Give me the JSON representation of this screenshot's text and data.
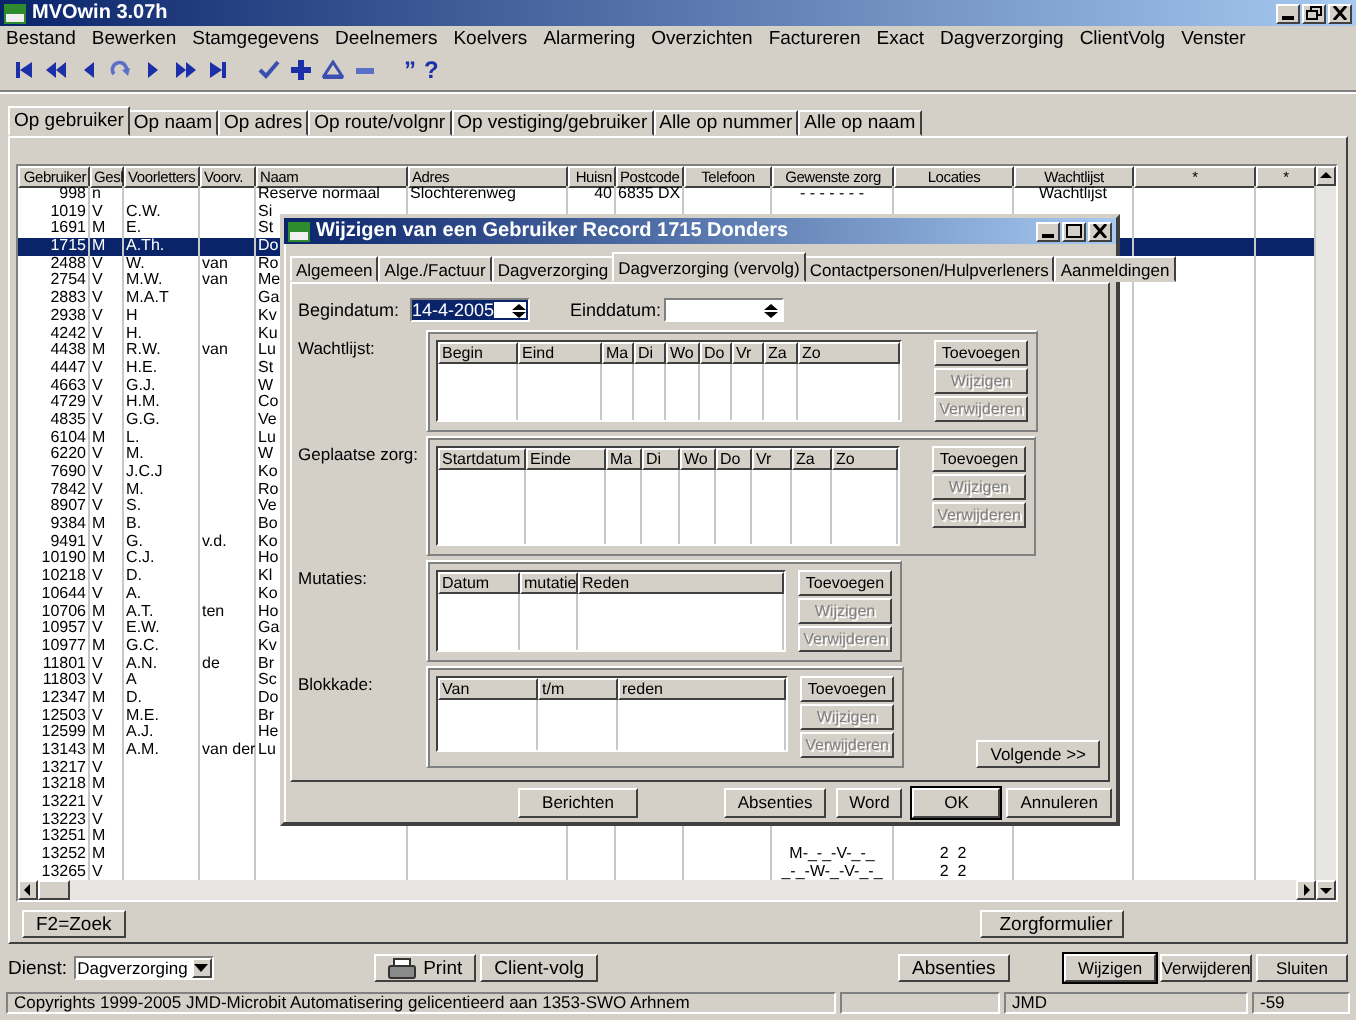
{
  "window": {
    "title": "MVOwin 3.07h"
  },
  "menu": [
    "Bestand",
    "Bewerken",
    "Stamgegevens",
    "Deelnemers",
    "Koelvers",
    "Alarmering",
    "Overzichten",
    "Factureren",
    "Exact",
    "Dagverzorging",
    "ClientVolg",
    "Venster"
  ],
  "toolbar": [
    {
      "kind": "first"
    },
    {
      "kind": "rewind"
    },
    {
      "kind": "previous"
    },
    {
      "kind": "refresh"
    },
    {
      "kind": "next"
    },
    {
      "kind": "forward"
    },
    {
      "kind": "last"
    },
    {
      "kind": "confirm"
    },
    {
      "kind": "add"
    },
    {
      "kind": "edit"
    },
    {
      "kind": "remove"
    },
    {
      "kind": "text",
      "text": "”"
    },
    {
      "kind": "text",
      "text": "?"
    }
  ],
  "tabs": [
    {
      "label": "Op gebruiker",
      "selected": true
    },
    {
      "label": "Op naam",
      "selected": false
    },
    {
      "label": "Op  adres",
      "selected": false
    },
    {
      "label": "Op route/volgnr",
      "selected": false
    },
    {
      "label": "Op vestiging/gebruiker",
      "selected": false
    },
    {
      "label": "Alle op nummer",
      "selected": false
    },
    {
      "label": "Alle op naam",
      "selected": false
    }
  ],
  "table": {
    "columns": [
      "Gebruiker",
      "Gesl",
      "Voorletters",
      "Voorv.",
      "Naam",
      "Adres",
      "Huisn",
      "Postcode",
      "Telefoon",
      "Gewenste zorg",
      "Locaties",
      "Wachtlijst",
      "*",
      "*"
    ],
    "rows": [
      {
        "gebruiker": "998",
        "gesl": "n",
        "naam": "Reserve normaal",
        "adres": "Slochterenweg",
        "huisnr": "40",
        "postcode": "6835 DX",
        "zorg": "- - - - - - -",
        "wachtlijst": "Wachtlijst",
        "selected": false
      },
      {
        "gebruiker": "1019",
        "gesl": "V",
        "voorletters": "C.W.",
        "naam": "Si",
        "selected": false
      },
      {
        "gebruiker": "1691",
        "gesl": "M",
        "voorletters": "E.",
        "naam": "St",
        "selected": false
      },
      {
        "gebruiker": "1715",
        "gesl": "M",
        "voorletters": "A.Th.",
        "naam": "Do",
        "selected": true
      },
      {
        "gebruiker": "2488",
        "gesl": "V",
        "voorletters": "W.",
        "voorv": "van",
        "naam": "Ro",
        "selected": false
      },
      {
        "gebruiker": "2754",
        "gesl": "V",
        "voorletters": "M.W.",
        "voorv": "van",
        "naam": "Me",
        "selected": false
      },
      {
        "gebruiker": "2883",
        "gesl": "V",
        "voorletters": "M.A.T",
        "naam": "Ga",
        "selected": false
      },
      {
        "gebruiker": "2938",
        "gesl": "V",
        "voorletters": "H",
        "naam": "Kv",
        "selected": false
      },
      {
        "gebruiker": "4242",
        "gesl": "V",
        "voorletters": "H.",
        "naam": "Ku",
        "selected": false
      },
      {
        "gebruiker": "4438",
        "gesl": "M",
        "voorletters": "R.W.",
        "voorv": "van",
        "naam": "Lu",
        "selected": false
      },
      {
        "gebruiker": "4447",
        "gesl": "V",
        "voorletters": "H.E.",
        "naam": "St",
        "selected": false
      },
      {
        "gebruiker": "4663",
        "gesl": "V",
        "voorletters": "G.J.",
        "naam": "W",
        "selected": false
      },
      {
        "gebruiker": "4729",
        "gesl": "V",
        "voorletters": "H.M.",
        "naam": "Co",
        "selected": false
      },
      {
        "gebruiker": "4835",
        "gesl": "V",
        "voorletters": "G.G.",
        "naam": "Ve",
        "selected": false
      },
      {
        "gebruiker": "6104",
        "gesl": "M",
        "voorletters": "L.",
        "naam": "Lu",
        "selected": false
      },
      {
        "gebruiker": "6220",
        "gesl": "V",
        "voorletters": "M.",
        "naam": "W",
        "selected": false
      },
      {
        "gebruiker": "7690",
        "gesl": "V",
        "voorletters": "J.C.J",
        "naam": "Ko",
        "selected": false
      },
      {
        "gebruiker": "7842",
        "gesl": "V",
        "voorletters": "M.",
        "naam": "Ro",
        "selected": false
      },
      {
        "gebruiker": "8907",
        "gesl": "V",
        "voorletters": "S.",
        "naam": "Ve",
        "selected": false
      },
      {
        "gebruiker": "9384",
        "gesl": "M",
        "voorletters": "B.",
        "naam": "Bo",
        "selected": false
      },
      {
        "gebruiker": "9491",
        "gesl": "V",
        "voorletters": "G.",
        "voorv": "v.d.",
        "naam": "Ko",
        "selected": false
      },
      {
        "gebruiker": "10190",
        "gesl": "M",
        "voorletters": "C.J.",
        "naam": "Ho",
        "selected": false
      },
      {
        "gebruiker": "10218",
        "gesl": "V",
        "voorletters": "D.",
        "naam": "Kl",
        "selected": false
      },
      {
        "gebruiker": "10644",
        "gesl": "V",
        "voorletters": "A.",
        "naam": "Ko",
        "selected": false
      },
      {
        "gebruiker": "10706",
        "gesl": "M",
        "voorletters": "A.T.",
        "voorv": "ten",
        "naam": "Ho",
        "selected": false
      },
      {
        "gebruiker": "10957",
        "gesl": "V",
        "voorletters": "E.W.",
        "naam": "Ga",
        "selected": false
      },
      {
        "gebruiker": "10977",
        "gesl": "M",
        "voorletters": "G.C.",
        "naam": "Kv",
        "selected": false
      },
      {
        "gebruiker": "11801",
        "gesl": "V",
        "voorletters": "A.N.",
        "voorv": "de",
        "naam": "Br",
        "selected": false
      },
      {
        "gebruiker": "11803",
        "gesl": "V",
        "voorletters": "A",
        "naam": "Sc",
        "selected": false
      },
      {
        "gebruiker": "12347",
        "gesl": "M",
        "voorletters": "D.",
        "naam": "Do",
        "selected": false
      },
      {
        "gebruiker": "12503",
        "gesl": "V",
        "voorletters": "M.E.",
        "naam": "Br",
        "selected": false
      },
      {
        "gebruiker": "12599",
        "gesl": "M",
        "voorletters": "A.J.",
        "naam": "He",
        "selected": false
      },
      {
        "gebruiker": "13143",
        "gesl": "M",
        "voorletters": "A.M.",
        "voorv": "van der",
        "naam": "Lu",
        "selected": false
      },
      {
        "gebruiker": "13217",
        "gesl": "V",
        "selected": false
      },
      {
        "gebruiker": "13218",
        "gesl": "M",
        "selected": false
      },
      {
        "gebruiker": "13221",
        "gesl": "V",
        "selected": false
      },
      {
        "gebruiker": "13223",
        "gesl": "V",
        "selected": false
      },
      {
        "gebruiker": "13251",
        "gesl": "M",
        "selected": false
      },
      {
        "gebruiker": "13252",
        "gesl": "M",
        "zorg": "M-_-_-V-_-_",
        "locaties": "2  2",
        "selected": false
      },
      {
        "gebruiker": "13265",
        "gesl": "V",
        "zorg": "_-_-W-_-V-_-_",
        "locaties": "2  2",
        "selected": false
      }
    ]
  },
  "search_button": "F2=Zoek",
  "form_button": "Zorgformulier",
  "service": {
    "label": "Dienst:",
    "value": "Dagverzorging"
  },
  "print_buttons": [
    "Print",
    "Client-volg"
  ],
  "center_buttons": [
    "Absenties"
  ],
  "action_buttons": [
    {
      "label": "Wijzigen",
      "default": true
    },
    {
      "label": "Verwijderen",
      "default": false
    },
    {
      "label": "Sluiten",
      "default": false
    }
  ],
  "status_bar": [
    "Copyrights 1999-2005 JMD-Microbit Automatisering gelicentieerd aan 1353-SWO Arhnem",
    "JMD",
    "-59"
  ],
  "dialog": {
    "title": "Wijzigen van een Gebruiker Record 1715 Donders",
    "tabs": [
      {
        "label": "Algemeen",
        "selected": false
      },
      {
        "label": "Alge./Factuur",
        "selected": false
      },
      {
        "label": "Dagverzorging",
        "selected": false
      },
      {
        "label": "Dagverzorging (vervolg)",
        "selected": true
      },
      {
        "label": "Contactpersonen/Hulpverleners",
        "selected": false
      },
      {
        "label": "Aanmeldingen",
        "selected": false
      }
    ],
    "dates": [
      {
        "label": "Begindatum:",
        "value": "14-4-2005",
        "highlighted": true
      },
      {
        "label": "Einddatum:",
        "highlighted": false
      }
    ],
    "sections": [
      {
        "label": "Wachtlijst:",
        "columns": [
          "Begin",
          "Eind",
          "Ma",
          "Di",
          "Wo",
          "Do",
          "Vr",
          "Za",
          "Zo"
        ],
        "buttons": [
          {
            "label": "Toevoegen",
            "disabled": false
          },
          {
            "label": "Wijzigen",
            "disabled": true
          },
          {
            "label": "Verwijderen",
            "disabled": true
          }
        ]
      },
      {
        "label": "Geplaatse zorg:",
        "columns": [
          "Startdatum",
          "Einde",
          "Ma",
          "Di",
          "Wo",
          "Do",
          "Vr",
          "Za",
          "Zo"
        ],
        "buttons": [
          {
            "label": "Toevoegen",
            "disabled": false
          },
          {
            "label": "Wijzigen",
            "disabled": true
          },
          {
            "label": "Verwijderen",
            "disabled": true
          }
        ]
      },
      {
        "label": "Mutaties:",
        "columns": [
          "Datum",
          "mutatie",
          "Reden"
        ],
        "buttons": [
          {
            "label": "Toevoegen",
            "disabled": false
          },
          {
            "label": "Wijzigen",
            "disabled": true
          },
          {
            "label": "Verwijderen",
            "disabled": true
          }
        ]
      },
      {
        "label": "Blokkade:",
        "columns": [
          "Van",
          "t/m",
          "reden"
        ],
        "buttons": [
          {
            "label": "Toevoegen",
            "disabled": false
          },
          {
            "label": "Wijzigen",
            "disabled": true
          },
          {
            "label": "Verwijderen",
            "disabled": true
          }
        ]
      }
    ],
    "next_button": "Volgende >>",
    "footer_buttons": [
      {
        "label": "Berichten",
        "default": false
      },
      {
        "label": "Absenties",
        "default": false
      },
      {
        "label": "Word",
        "default": false
      },
      {
        "label": "OK",
        "default": true
      },
      {
        "label": "Annuleren",
        "default": false
      }
    ]
  }
}
